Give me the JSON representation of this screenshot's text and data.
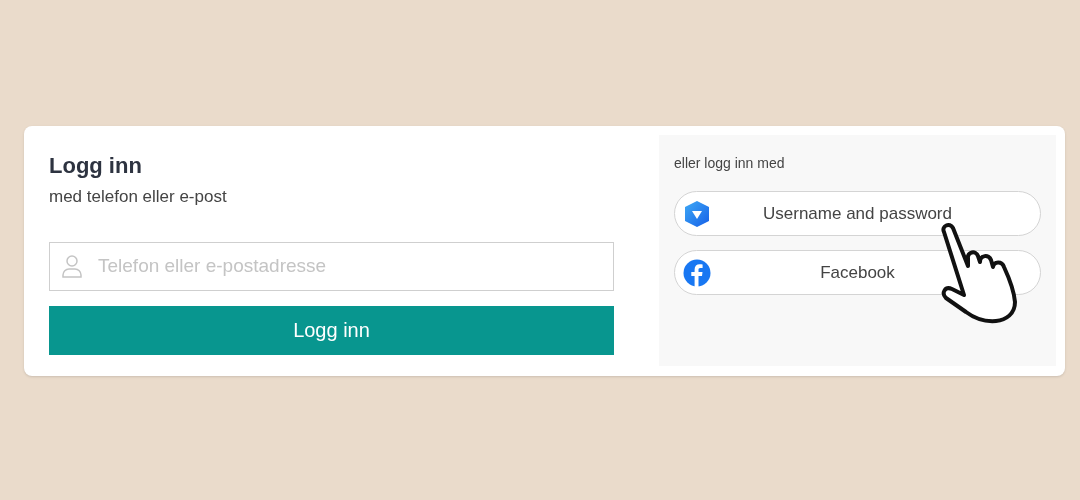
{
  "login": {
    "title": "Logg inn",
    "subtitle": "med telefon eller e-post",
    "field": {
      "placeholder": "Telefon eller e-postadresse"
    },
    "button": "Logg inn"
  },
  "alternatives": {
    "heading": "eller logg inn med",
    "providers": [
      {
        "kind": "shield",
        "label": "Username and password"
      },
      {
        "kind": "facebook",
        "label": "Facebook"
      }
    ]
  }
}
